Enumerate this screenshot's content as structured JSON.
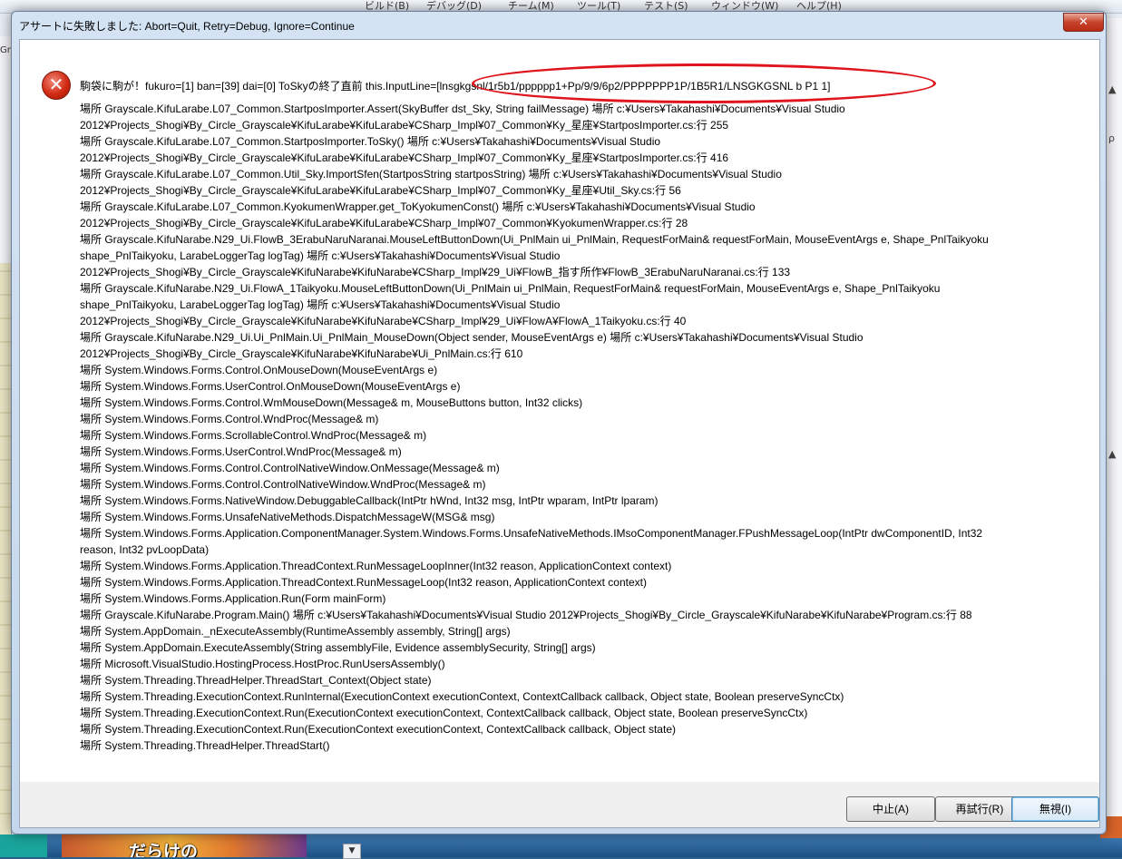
{
  "background": {
    "menu_items": [
      "ビルド(B)",
      "デバッグ(D)",
      "チーム(M)",
      "ツール(T)",
      "テスト(S)",
      "ウィンドウ(W)",
      "ヘルプ(H)"
    ],
    "left_glyph": "Gr",
    "right_glyphs": [
      "▲",
      "ρ",
      "▲"
    ],
    "thumbnail_text": "だらけの",
    "scroll_glyph": "▼"
  },
  "dialog": {
    "title": "アサートに失敗しました: Abort=Quit, Retry=Debug, Ignore=Continue",
    "close_glyph": "✕",
    "icon_glyph": "✕",
    "message_first_line": "駒袋に駒が！fukuro=[1] ban=[39] dai=[0] ToSkyの終了直前 this.InputLine=[lnsgkgsnl/1r5b1/pppppp1+Pp/9/9/6p2/PPPPPPP1P/1B5R1/LNSGKGSNL b P1 1]",
    "stack_lines": [
      "   場所 Grayscale.KifuLarabe.L07_Common.StartposImporter.Assert(SkyBuffer dst_Sky, String failMessage) 場所 c:¥Users¥Takahashi¥Documents¥Visual Studio",
      "2012¥Projects_Shogi¥By_Circle_Grayscale¥KifuLarabe¥KifuLarabe¥CSharp_Impl¥07_Common¥Ky_星座¥StartposImporter.cs:行 255",
      "   場所 Grayscale.KifuLarabe.L07_Common.StartposImporter.ToSky() 場所 c:¥Users¥Takahashi¥Documents¥Visual Studio",
      "2012¥Projects_Shogi¥By_Circle_Grayscale¥KifuLarabe¥KifuLarabe¥CSharp_Impl¥07_Common¥Ky_星座¥StartposImporter.cs:行 416",
      "   場所 Grayscale.KifuLarabe.L07_Common.Util_Sky.ImportSfen(StartposString startposString) 場所 c:¥Users¥Takahashi¥Documents¥Visual Studio",
      "2012¥Projects_Shogi¥By_Circle_Grayscale¥KifuLarabe¥KifuLarabe¥CSharp_Impl¥07_Common¥Ky_星座¥Util_Sky.cs:行 56",
      "   場所 Grayscale.KifuLarabe.L07_Common.KyokumenWrapper.get_ToKyokumenConst() 場所 c:¥Users¥Takahashi¥Documents¥Visual Studio",
      "2012¥Projects_Shogi¥By_Circle_Grayscale¥KifuLarabe¥KifuLarabe¥CSharp_Impl¥07_Common¥KyokumenWrapper.cs:行 28",
      "   場所 Grayscale.KifuNarabe.N29_Ui.FlowB_3ErabuNaruNaranai.MouseLeftButtonDown(Ui_PnlMain ui_PnlMain, RequestForMain& requestForMain, MouseEventArgs e, Shape_PnlTaikyoku",
      "shape_PnlTaikyoku, LarabeLoggerTag logTag) 場所 c:¥Users¥Takahashi¥Documents¥Visual Studio",
      "2012¥Projects_Shogi¥By_Circle_Grayscale¥KifuNarabe¥KifuNarabe¥CSharp_Impl¥29_Ui¥FlowB_指す所作¥FlowB_3ErabuNaruNaranai.cs:行 133",
      "   場所 Grayscale.KifuNarabe.N29_Ui.FlowA_1Taikyoku.MouseLeftButtonDown(Ui_PnlMain ui_PnlMain, RequestForMain& requestForMain, MouseEventArgs e, Shape_PnlTaikyoku",
      "shape_PnlTaikyoku, LarabeLoggerTag logTag) 場所 c:¥Users¥Takahashi¥Documents¥Visual Studio",
      "2012¥Projects_Shogi¥By_Circle_Grayscale¥KifuNarabe¥KifuNarabe¥CSharp_Impl¥29_Ui¥FlowA¥FlowA_1Taikyoku.cs:行 40",
      "   場所 Grayscale.KifuNarabe.N29_Ui.Ui_PnlMain.Ui_PnlMain_MouseDown(Object sender, MouseEventArgs e) 場所 c:¥Users¥Takahashi¥Documents¥Visual Studio",
      "2012¥Projects_Shogi¥By_Circle_Grayscale¥KifuNarabe¥KifuNarabe¥Ui_PnlMain.cs:行 610",
      "   場所 System.Windows.Forms.Control.OnMouseDown(MouseEventArgs e)",
      "   場所 System.Windows.Forms.UserControl.OnMouseDown(MouseEventArgs e)",
      "   場所 System.Windows.Forms.Control.WmMouseDown(Message& m, MouseButtons button, Int32 clicks)",
      "   場所 System.Windows.Forms.Control.WndProc(Message& m)",
      "   場所 System.Windows.Forms.ScrollableControl.WndProc(Message& m)",
      "   場所 System.Windows.Forms.UserControl.WndProc(Message& m)",
      "   場所 System.Windows.Forms.Control.ControlNativeWindow.OnMessage(Message& m)",
      "   場所 System.Windows.Forms.Control.ControlNativeWindow.WndProc(Message& m)",
      "   場所 System.Windows.Forms.NativeWindow.DebuggableCallback(IntPtr hWnd, Int32 msg, IntPtr wparam, IntPtr lparam)",
      "   場所 System.Windows.Forms.UnsafeNativeMethods.DispatchMessageW(MSG& msg)",
      "   場所 System.Windows.Forms.Application.ComponentManager.System.Windows.Forms.UnsafeNativeMethods.IMsoComponentManager.FPushMessageLoop(IntPtr dwComponentID, Int32",
      "reason, Int32 pvLoopData)",
      "   場所 System.Windows.Forms.Application.ThreadContext.RunMessageLoopInner(Int32 reason, ApplicationContext context)",
      "   場所 System.Windows.Forms.Application.ThreadContext.RunMessageLoop(Int32 reason, ApplicationContext context)",
      "   場所 System.Windows.Forms.Application.Run(Form mainForm)",
      "   場所 Grayscale.KifuNarabe.Program.Main() 場所 c:¥Users¥Takahashi¥Documents¥Visual Studio 2012¥Projects_Shogi¥By_Circle_Grayscale¥KifuNarabe¥KifuNarabe¥Program.cs:行 88",
      "   場所 System.AppDomain._nExecuteAssembly(RuntimeAssembly assembly, String[] args)",
      "   場所 System.AppDomain.ExecuteAssembly(String assemblyFile, Evidence assemblySecurity, String[] args)",
      "   場所 Microsoft.VisualStudio.HostingProcess.HostProc.RunUsersAssembly()",
      "   場所 System.Threading.ThreadHelper.ThreadStart_Context(Object state)",
      "   場所 System.Threading.ExecutionContext.RunInternal(ExecutionContext executionContext, ContextCallback callback, Object state, Boolean preserveSyncCtx)",
      "   場所 System.Threading.ExecutionContext.Run(ExecutionContext executionContext, ContextCallback callback, Object state, Boolean preserveSyncCtx)",
      "   場所 System.Threading.ExecutionContext.Run(ExecutionContext executionContext, ContextCallback callback, Object state)",
      "   場所 System.Threading.ThreadHelper.ThreadStart()"
    ],
    "buttons": {
      "abort_label": "中止(A)",
      "retry_label": "再試行(R)",
      "ignore_label": "無視(I)"
    }
  }
}
